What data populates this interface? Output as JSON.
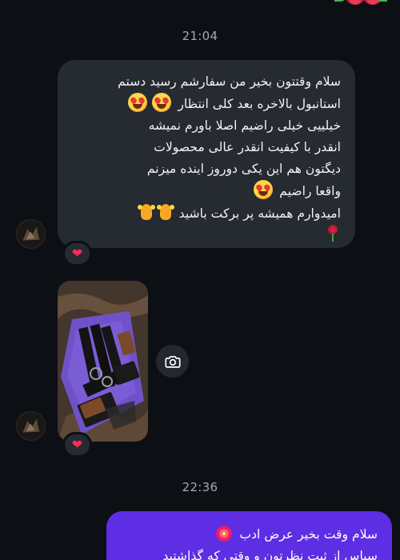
{
  "timestamps": {
    "first": "21:04",
    "second": "22:36"
  },
  "incoming_message": {
    "lines": [
      "سلام وقتتون بخیر من سفارشم رسید دستم",
      "استانبول بالاخره  بعد کلی انتظار",
      "خیلییی خیلی راضیم اصلا باورم نمیشه",
      "انقدر با کیفیت انقدر عالی  محصولات",
      "دیگتون هم این یکی دوروز اینده میزنم",
      "واقعا راضیم",
      "امیدوارم همیشه پر برکت باشید"
    ],
    "reaction": "❤"
  },
  "photo_message": {
    "reaction": "❤",
    "icon": "camera-icon"
  },
  "outgoing_message": {
    "lines": [
      "سلام وقت بخیر عرض ادب",
      "سپاس از ثبت نظرتون و وقتی که گذاشتید"
    ]
  },
  "colors": {
    "background": "#0c0f14",
    "incoming_bubble": "#262a31",
    "outgoing_bubble": "#5d2ee3",
    "heart": "#ff2d55",
    "timestamp_text": "#a6a9b0"
  }
}
